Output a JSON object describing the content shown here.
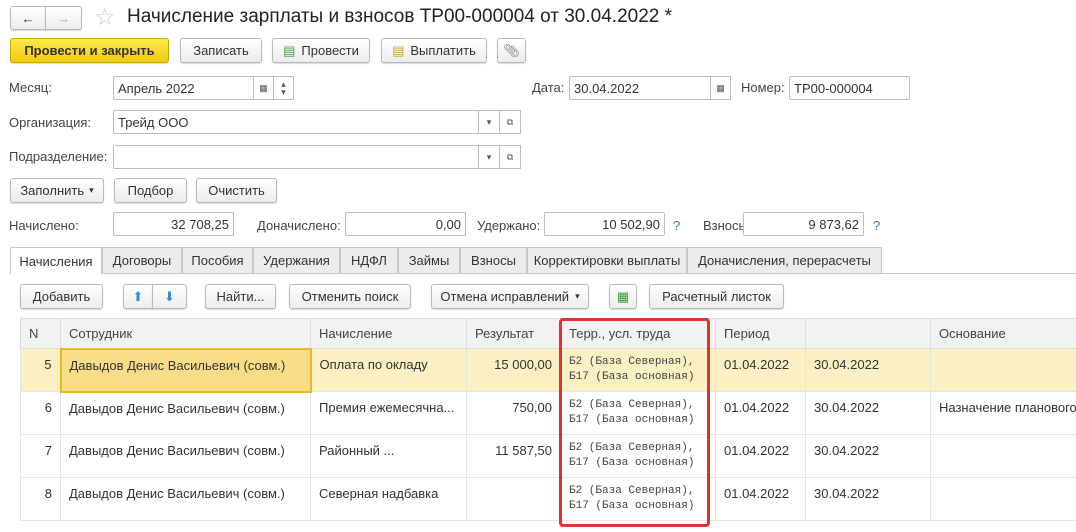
{
  "header": {
    "title": "Начисление зарплаты и взносов ТР00-000004 от 30.04.2022 *"
  },
  "toolbar": {
    "post_close": "Провести и закрыть",
    "save": "Записать",
    "post": "Провести",
    "pay": "Выплатить"
  },
  "form": {
    "month_label": "Месяц:",
    "month_value": "Апрель 2022",
    "date_label": "Дата:",
    "date_value": "30.04.2022",
    "number_label": "Номер:",
    "number_value": "ТР00-000004",
    "org_label": "Организация:",
    "org_value": "Трейд ООО",
    "dept_label": "Подразделение:",
    "dept_value": ""
  },
  "actions": {
    "fill": "Заполнить",
    "select": "Подбор",
    "clear": "Очистить"
  },
  "totals": {
    "accrued_label": "Начислено:",
    "accrued": "32 708,25",
    "extra_label": "Доначислено:",
    "extra": "0,00",
    "withheld_label": "Удержано:",
    "withheld": "10 502,90",
    "contrib_label": "Взносы:",
    "contrib": "9 873,62",
    "help": "?"
  },
  "tabs": [
    "Начисления",
    "Договоры",
    "Пособия",
    "Удержания",
    "НДФЛ",
    "Займы",
    "Взносы",
    "Корректировки выплаты",
    "Доначисления, перерасчеты"
  ],
  "table_toolbar": {
    "add": "Добавить",
    "find": "Найти...",
    "cancel_search": "Отменить поиск",
    "cancel_fix": "Отмена исправлений",
    "payslip": "Расчетный листок"
  },
  "table": {
    "columns": [
      "N",
      "Сотрудник",
      "Начисление",
      "Результат",
      "Терр., усл. труда",
      "Период",
      "",
      "Основание"
    ],
    "rows": [
      {
        "n": "5",
        "employee": "Давыдов Денис Васильевич (совм.)",
        "accrual": "Оплата по окладу",
        "result": "15 000,00",
        "terr1": "Б2 (База Северная),",
        "terr2": "Б17 (База основная)",
        "from": "01.04.2022",
        "to": "30.04.2022",
        "basis": ""
      },
      {
        "n": "6",
        "employee": "Давыдов Денис Васильевич (совм.)",
        "accrual": "Премия ежемесячна...",
        "result": "750,00",
        "terr1": "Б2 (База Северная),",
        "terr2": "Б17 (База основная)",
        "from": "01.04.2022",
        "to": "30.04.2022",
        "basis": "Назначение планового"
      },
      {
        "n": "7",
        "employee": "Давыдов Денис Васильевич (совм.)",
        "accrual": "Районный ...",
        "result": "11 587,50",
        "terr1": "Б2 (База Северная),",
        "terr2": "Б17 (База основная)",
        "from": "01.04.2022",
        "to": "30.04.2022",
        "basis": ""
      },
      {
        "n": "8",
        "employee": "Давыдов Денис Васильевич (совм.)",
        "accrual": "Северная надбавка",
        "result": "",
        "terr1": "Б2 (База Северная),",
        "terr2": "Б17 (База основная)",
        "from": "01.04.2022",
        "to": "30.04.2022",
        "basis": ""
      }
    ]
  }
}
